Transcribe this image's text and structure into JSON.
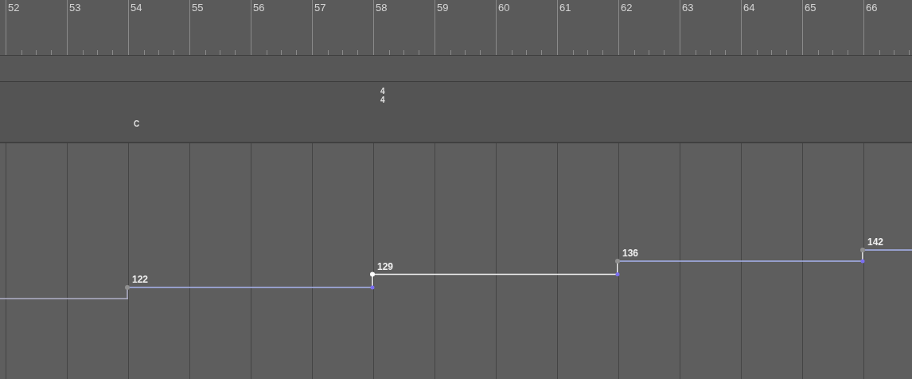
{
  "bars": [
    {
      "label": "52"
    },
    {
      "label": "53"
    },
    {
      "label": "54",
      "key": "C",
      "tempo": {
        "label": "122",
        "selected": true
      }
    },
    {
      "label": "55"
    },
    {
      "label": "56"
    },
    {
      "label": "57"
    },
    {
      "label": "58",
      "time_signature": [
        "4",
        "4"
      ],
      "tempo": {
        "label": "129",
        "selected": false
      }
    },
    {
      "label": "59"
    },
    {
      "label": "60"
    },
    {
      "label": "61"
    },
    {
      "label": "62",
      "tempo": {
        "label": "136",
        "selected": true
      }
    },
    {
      "label": "63"
    },
    {
      "label": "64"
    },
    {
      "label": "65"
    },
    {
      "label": "66",
      "tempo": {
        "label": "142",
        "selected": true
      }
    }
  ]
}
